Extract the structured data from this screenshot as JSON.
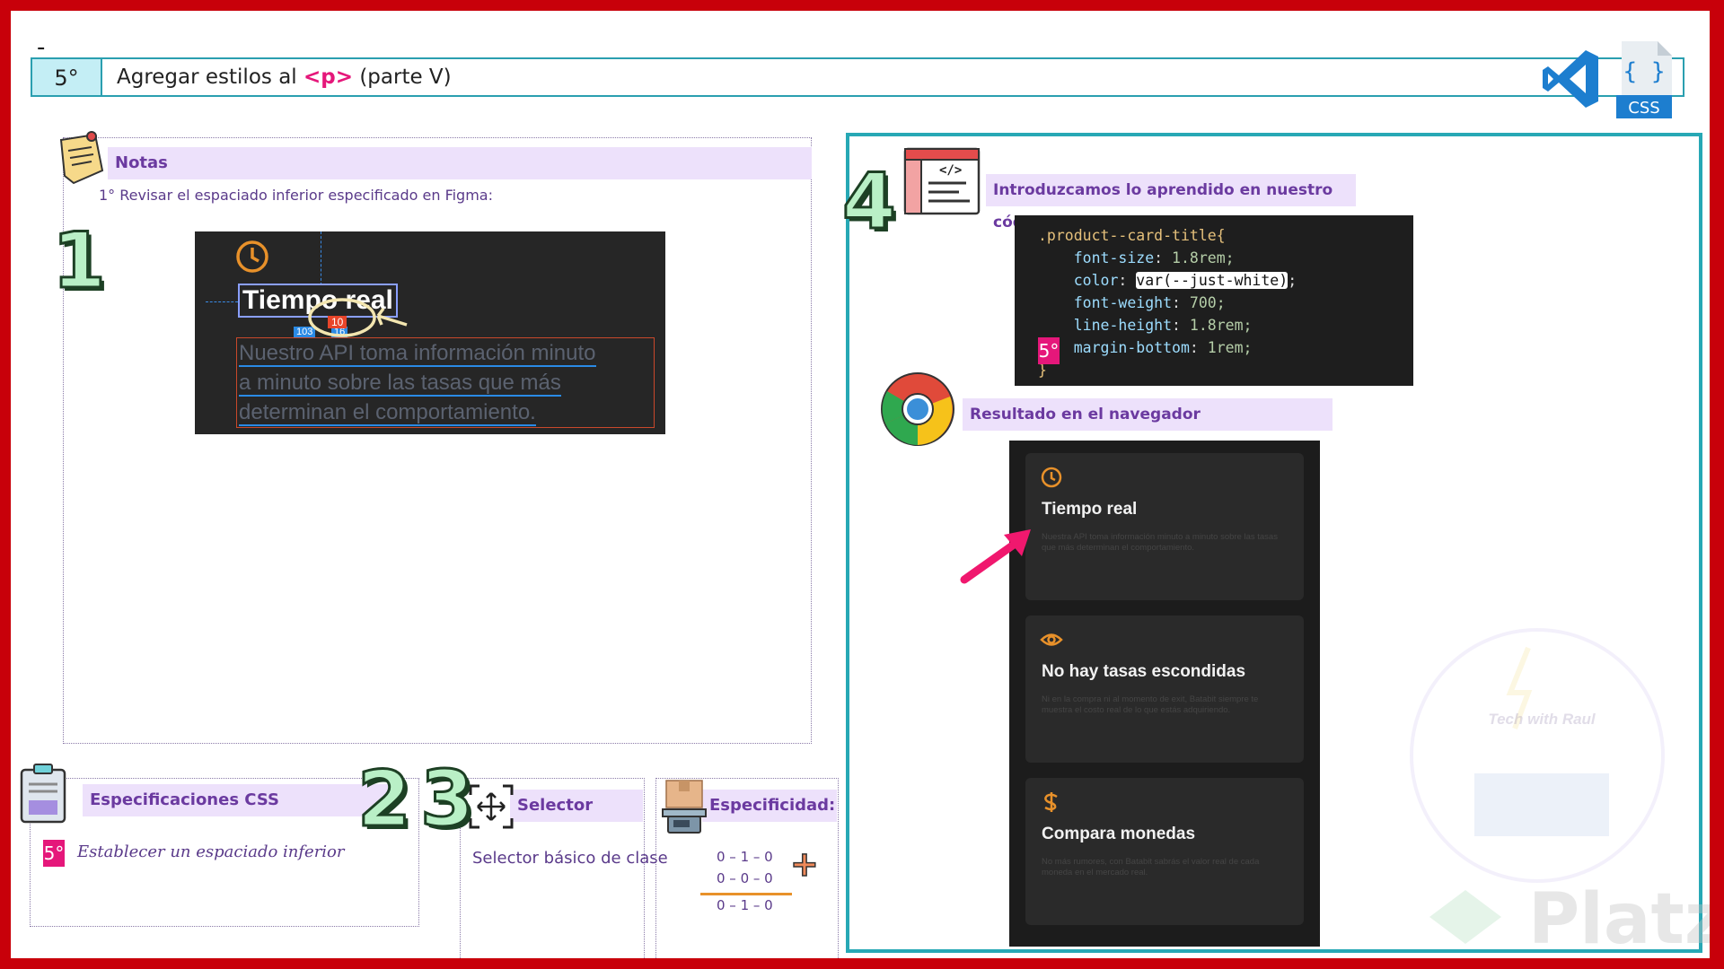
{
  "header": {
    "dash": "-",
    "step_number": "5°",
    "title_prefix": "Agregar estilos al ",
    "title_tag": "<p>",
    "title_suffix": " (parte V)",
    "css_icon_label": "CSS",
    "icons": [
      "vscode-icon",
      "css-file-icon"
    ]
  },
  "notes": {
    "heading": "Notas",
    "step_badge": "1",
    "item1": "1° Revisar el espaciado inferior especificado en Figma:",
    "figma": {
      "title": "Tiempo real",
      "measure_main": "10",
      "measure_left": "103",
      "measure_right": "16",
      "paragraph_line1": "Nuestro API toma información minuto",
      "paragraph_line2": "a minuto sobre las tasas que más",
      "paragraph_line3": "determinan el comportamiento."
    }
  },
  "specs": {
    "heading": "Especificaciones CSS",
    "badge": "5°",
    "item": "Establecer un espaciado inferior",
    "step_badge": "2"
  },
  "selector": {
    "step_badge": "3",
    "heading": "Selector",
    "text": "Selector básico de clase"
  },
  "specificity": {
    "heading": "Especificidad:",
    "row1": "0 – 1 – 0",
    "row2": "0 – 0 – 0",
    "result": "0 – 1 – 0",
    "plus": "+"
  },
  "code_section": {
    "step_badge": "4",
    "heading": "Introduzcamos lo aprendido en nuestro código",
    "badge": "5°",
    "lines": {
      "l1_sel": ".product--card-title{",
      "l2_prop": "font-size",
      "l2_val": " 1.8rem;",
      "l3_prop": "color",
      "l3_val": "var(--just-white)",
      "l3_end": ";",
      "l4_prop": "font-weight",
      "l4_val": " 700;",
      "l5_prop": "line-height",
      "l5_val": " 1.8rem;",
      "l6_prop": "margin-bottom",
      "l6_val": " 1rem;",
      "l7": "}"
    }
  },
  "browser_section": {
    "heading": "Resultado en el navegador",
    "cards": [
      {
        "title": "Tiempo real",
        "desc": "Nuestra API toma información minuto a minuto sobre las tasas que más determinan el comportamiento.",
        "icon": "clock-icon"
      },
      {
        "title": "No hay tasas escondidas",
        "desc": "Ni en la compra ni al momento de exit, Batabit siempre te muestra el costo real de lo que estás adquiriendo.",
        "icon": "eye-icon"
      },
      {
        "title": "Compara monedas",
        "desc": "No más rumores, con Batabit sabrás el valor real de cada moneda en el mercado real.",
        "icon": "dollar-icon"
      }
    ]
  },
  "watermark": {
    "brand": "Platzi",
    "mascot": "Tech with Raul"
  },
  "colors": {
    "frame": "#c8000a",
    "accent_teal": "#27a8b5",
    "accent_pink": "#e5177a",
    "section_bg": "#ede1fb",
    "orange_icon": "#e8912a"
  }
}
